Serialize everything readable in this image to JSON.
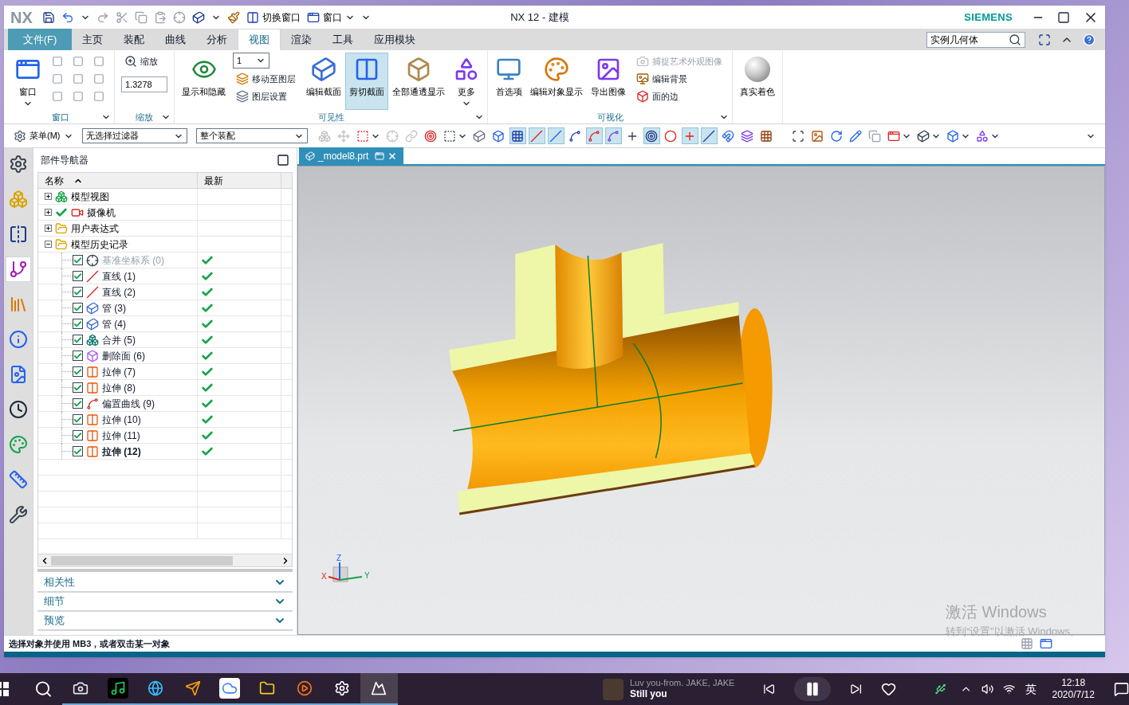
{
  "title_bar": {
    "logo": "NX",
    "quick_access": [
      {
        "label": "切换窗口",
        "kind": "switch"
      },
      {
        "label": "窗口",
        "kind": "window"
      }
    ],
    "title": "NX 12 - 建模",
    "brand": "SIEMENS"
  },
  "tabs": [
    {
      "label": "文件(F)",
      "kind": "file",
      "selected": false
    },
    {
      "label": "主页",
      "kind": "tab",
      "selected": false
    },
    {
      "label": "装配",
      "kind": "tab",
      "selected": false
    },
    {
      "label": "曲线",
      "kind": "tab",
      "selected": false
    },
    {
      "label": "分析",
      "kind": "tab",
      "selected": false
    },
    {
      "label": "视图",
      "kind": "tab",
      "selected": true
    },
    {
      "label": "渲染",
      "kind": "tab",
      "selected": false
    },
    {
      "label": "工具",
      "kind": "tab",
      "selected": false
    },
    {
      "label": "应用模块",
      "kind": "tab",
      "selected": false
    }
  ],
  "command_search": {
    "value": "实例几何体"
  },
  "ribbon": [
    {
      "title": "窗口",
      "items": [
        {
          "kind": "large",
          "label": "窗口",
          "selected": false,
          "dropdown": true
        },
        {
          "kind": "layouts"
        }
      ]
    },
    {
      "title": "缩放",
      "items": [
        {
          "kind": "stack",
          "items": [
            {
              "kind": "small",
              "label": "缩放",
              "disabled": false
            },
            {
              "kind": "field",
              "value": "1.3278"
            }
          ]
        }
      ]
    },
    {
      "title": "可见性",
      "items": [
        {
          "kind": "large",
          "label": "显示和隐藏",
          "selected": false,
          "dropdown": false
        },
        {
          "kind": "stack",
          "items": [
            {
              "kind": "dropdown",
              "value": "1"
            },
            {
              "kind": "small",
              "label": "移动至图层",
              "disabled": false
            },
            {
              "kind": "small",
              "label": "图层设置",
              "disabled": false
            }
          ]
        },
        {
          "kind": "large",
          "label": "编辑截面",
          "selected": false,
          "dropdown": false
        },
        {
          "kind": "large",
          "label": "剪切截面",
          "selected": true,
          "dropdown": false
        },
        {
          "kind": "large",
          "label": "全部通透显示",
          "selected": false,
          "dropdown": false
        },
        {
          "kind": "large",
          "label": "更多",
          "selected": false,
          "dropdown": true
        }
      ]
    },
    {
      "title": "可视化",
      "items": [
        {
          "kind": "large",
          "label": "首选项",
          "selected": false,
          "dropdown": false
        },
        {
          "kind": "large",
          "label": "编辑对象显示",
          "selected": false,
          "dropdown": false
        },
        {
          "kind": "large",
          "label": "导出图像",
          "selected": false,
          "dropdown": false
        },
        {
          "kind": "stack",
          "items": [
            {
              "kind": "small",
              "label": "捕捉艺术外观图像",
              "disabled": true
            },
            {
              "kind": "small",
              "label": "编辑背景",
              "disabled": false
            },
            {
              "kind": "small",
              "label": "面的边",
              "disabled": false
            }
          ]
        }
      ]
    },
    {
      "items": [
        {
          "kind": "large",
          "label": "真实着色",
          "selected": false,
          "dropdown": false
        }
      ]
    }
  ],
  "toolbar": {
    "menu": "菜单(M)",
    "filters": [
      "无选择过滤器",
      "整个装配"
    ],
    "icons": [
      {
        "selected": false,
        "disabled": true,
        "dropdown": false
      },
      {
        "selected": false,
        "disabled": true,
        "dropdown": false
      },
      {
        "selected": false,
        "disabled": false,
        "dropdown": true
      },
      {
        "selected": false,
        "disabled": true,
        "dropdown": false
      },
      {
        "selected": false,
        "disabled": true,
        "dropdown": false
      },
      {
        "selected": false,
        "disabled": false,
        "dropdown": false
      },
      {
        "selected": false,
        "disabled": false,
        "dropdown": true
      },
      {
        "selected": false,
        "disabled": false,
        "dropdown": false
      },
      {
        "selected": false,
        "disabled": false,
        "dropdown": false
      },
      {
        "selected": true,
        "disabled": false,
        "dropdown": false
      },
      {
        "selected": true,
        "disabled": false,
        "dropdown": false
      },
      {
        "selected": true,
        "disabled": false,
        "dropdown": false
      },
      {
        "selected": false,
        "disabled": false,
        "dropdown": false
      },
      {
        "selected": true,
        "disabled": false,
        "dropdown": false
      },
      {
        "selected": true,
        "disabled": false,
        "dropdown": false
      },
      {
        "selected": false,
        "disabled": false,
        "dropdown": false
      },
      {
        "selected": true,
        "disabled": false,
        "dropdown": false
      },
      {
        "selected": false,
        "disabled": false,
        "dropdown": false
      },
      {
        "selected": true,
        "disabled": false,
        "dropdown": false
      },
      {
        "selected": true,
        "disabled": false,
        "dropdown": false
      },
      {
        "selected": false,
        "disabled": false,
        "dropdown": false
      },
      {
        "selected": false,
        "disabled": false,
        "dropdown": false
      },
      {
        "selected": false,
        "disabled": false,
        "dropdown": false
      },
      {
        "selected": false,
        "disabled": false,
        "dropdown": false
      },
      {
        "selected": false,
        "disabled": false,
        "dropdown": false
      },
      {
        "selected": false,
        "disabled": false,
        "dropdown": false
      },
      {
        "selected": false,
        "disabled": false,
        "dropdown": false
      },
      {
        "selected": false,
        "disabled": false,
        "dropdown": false
      },
      {
        "selected": false,
        "disabled": false,
        "dropdown": true
      },
      {
        "selected": false,
        "disabled": false,
        "dropdown": true
      },
      {
        "selected": false,
        "disabled": false,
        "dropdown": true
      },
      {
        "selected": false,
        "disabled": false,
        "dropdown": true
      }
    ]
  },
  "resource_bar": [
    {
      "selected": false
    },
    {
      "selected": false
    },
    {
      "selected": false
    },
    {
      "selected": true
    },
    {
      "selected": false
    },
    {
      "selected": false
    },
    {
      "selected": false
    },
    {
      "selected": false
    },
    {
      "selected": false
    },
    {
      "selected": false
    },
    {
      "selected": false
    }
  ],
  "part_navigator": {
    "title": "部件导航器",
    "columns": [
      "名称",
      "最新"
    ],
    "nodes": [
      {
        "label": "模型视图",
        "expanded": false
      },
      {
        "label": "摄像机",
        "expanded": false,
        "visible": true
      },
      {
        "label": "用户表达式",
        "expanded": false
      },
      {
        "label": "模型历史记录",
        "expanded": true,
        "children": [
          {
            "label": "基准坐标系 (0)",
            "kind": "datum",
            "checked": true,
            "latest": true,
            "suppressed": true,
            "current": false
          },
          {
            "label": "直线 (1)",
            "kind": "line",
            "checked": true,
            "latest": true,
            "suppressed": false,
            "current": false
          },
          {
            "label": "直线 (2)",
            "kind": "line",
            "checked": true,
            "latest": true,
            "suppressed": false,
            "current": false
          },
          {
            "label": "管 (3)",
            "kind": "tube",
            "checked": true,
            "latest": true,
            "suppressed": false,
            "current": false
          },
          {
            "label": "管 (4)",
            "kind": "tube",
            "checked": true,
            "latest": true,
            "suppressed": false,
            "current": false
          },
          {
            "label": "合并 (5)",
            "kind": "unite",
            "checked": true,
            "latest": true,
            "suppressed": false,
            "current": false
          },
          {
            "label": "删除面 (6)",
            "kind": "delete_face",
            "checked": true,
            "latest": true,
            "suppressed": false,
            "current": false
          },
          {
            "label": "拉伸 (7)",
            "kind": "extrude",
            "checked": true,
            "latest": true,
            "suppressed": false,
            "current": false
          },
          {
            "label": "拉伸 (8)",
            "kind": "extrude",
            "checked": true,
            "latest": true,
            "suppressed": false,
            "current": false
          },
          {
            "label": "偏置曲线 (9)",
            "kind": "offset_curve",
            "checked": true,
            "latest": true,
            "suppressed": false,
            "current": false
          },
          {
            "label": "拉伸 (10)",
            "kind": "extrude",
            "checked": true,
            "latest": true,
            "suppressed": false,
            "current": false
          },
          {
            "label": "拉伸 (11)",
            "kind": "extrude",
            "checked": true,
            "latest": true,
            "suppressed": false,
            "current": false
          },
          {
            "label": "拉伸 (12)",
            "kind": "extrude",
            "checked": true,
            "latest": true,
            "suppressed": false,
            "current": true
          }
        ]
      }
    ],
    "panels": [
      {
        "label": "相关性",
        "expanded": false
      },
      {
        "label": "细节",
        "expanded": false
      },
      {
        "label": "预览",
        "expanded": false
      }
    ]
  },
  "viewport": {
    "tab": "_model8.prt",
    "axis_labels": {
      "z": "Z",
      "x": "X",
      "y": "Y"
    }
  },
  "activation": {
    "title": "激活 Windows",
    "subtitle": "转到“设置”以激活 Windows。"
  },
  "status": "选择对象并使用 MB3，或者双击某一对象",
  "taskbar": {
    "apps": [
      {
        "selected": false
      },
      {
        "selected": false
      },
      {
        "selected": false
      },
      {
        "selected": false
      },
      {
        "selected": false
      },
      {
        "selected": false
      },
      {
        "selected": false
      },
      {
        "selected": false
      },
      {
        "selected": true
      }
    ],
    "media": {
      "artist": "Luv you-from. JAKE, JAKE",
      "song": "Still you",
      "playing": true
    },
    "ime": "英",
    "time": "12:18",
    "date": "2020/7/12"
  }
}
